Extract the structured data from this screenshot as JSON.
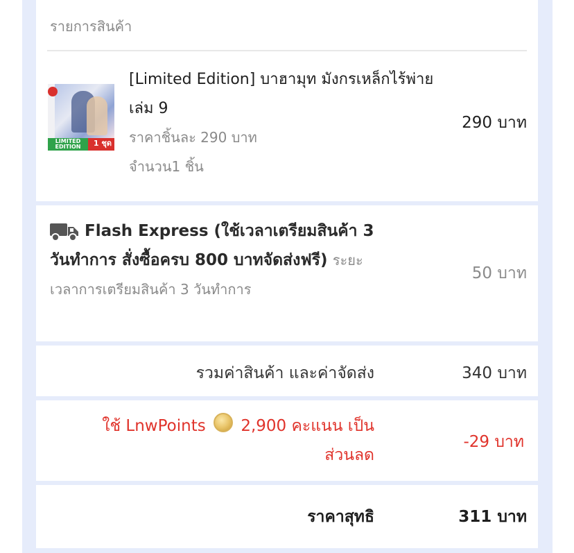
{
  "items_section": {
    "title": "รายการสินค้า",
    "items": [
      {
        "name": "[Limited Edition] บาฮามุท มังกรเหล็กไร้พ่าย เล่ม 9",
        "unit_price": "ราคาชิ้นละ 290 บาท",
        "quantity": "จำนวน1 ชิ้น",
        "total": "290 บาท",
        "thumbnail_badge": "LIMITED EDITION",
        "thumbnail_set": "1 ชุด"
      }
    ]
  },
  "shipping": {
    "icon": "truck-icon",
    "name": "Flash Express (ใช้เวลาเตรียมสินค้า 3 วันทำการ สั่งซื้อครบ 800 บาทจัดส่งฟรี)",
    "note": "ระยะเวลาการเตรียมสินค้า 3 วันทำการ",
    "price": "50 บาท"
  },
  "subtotal": {
    "label": "รวมค่าสินค้า และค่าจัดส่ง",
    "value": "340 บาท"
  },
  "points": {
    "prefix": "ใช้ LnwPoints",
    "icon": "coin-icon",
    "suffix": "2,900 คะแนน เป็นส่วนลด",
    "value": "-29 บาท"
  },
  "net": {
    "label": "ราคาสุทธิ",
    "value": "311 บาท"
  },
  "colors": {
    "panel_background": "#e6ecfb",
    "discount": "#e0332b",
    "muted_text": "#8a8a8a"
  }
}
